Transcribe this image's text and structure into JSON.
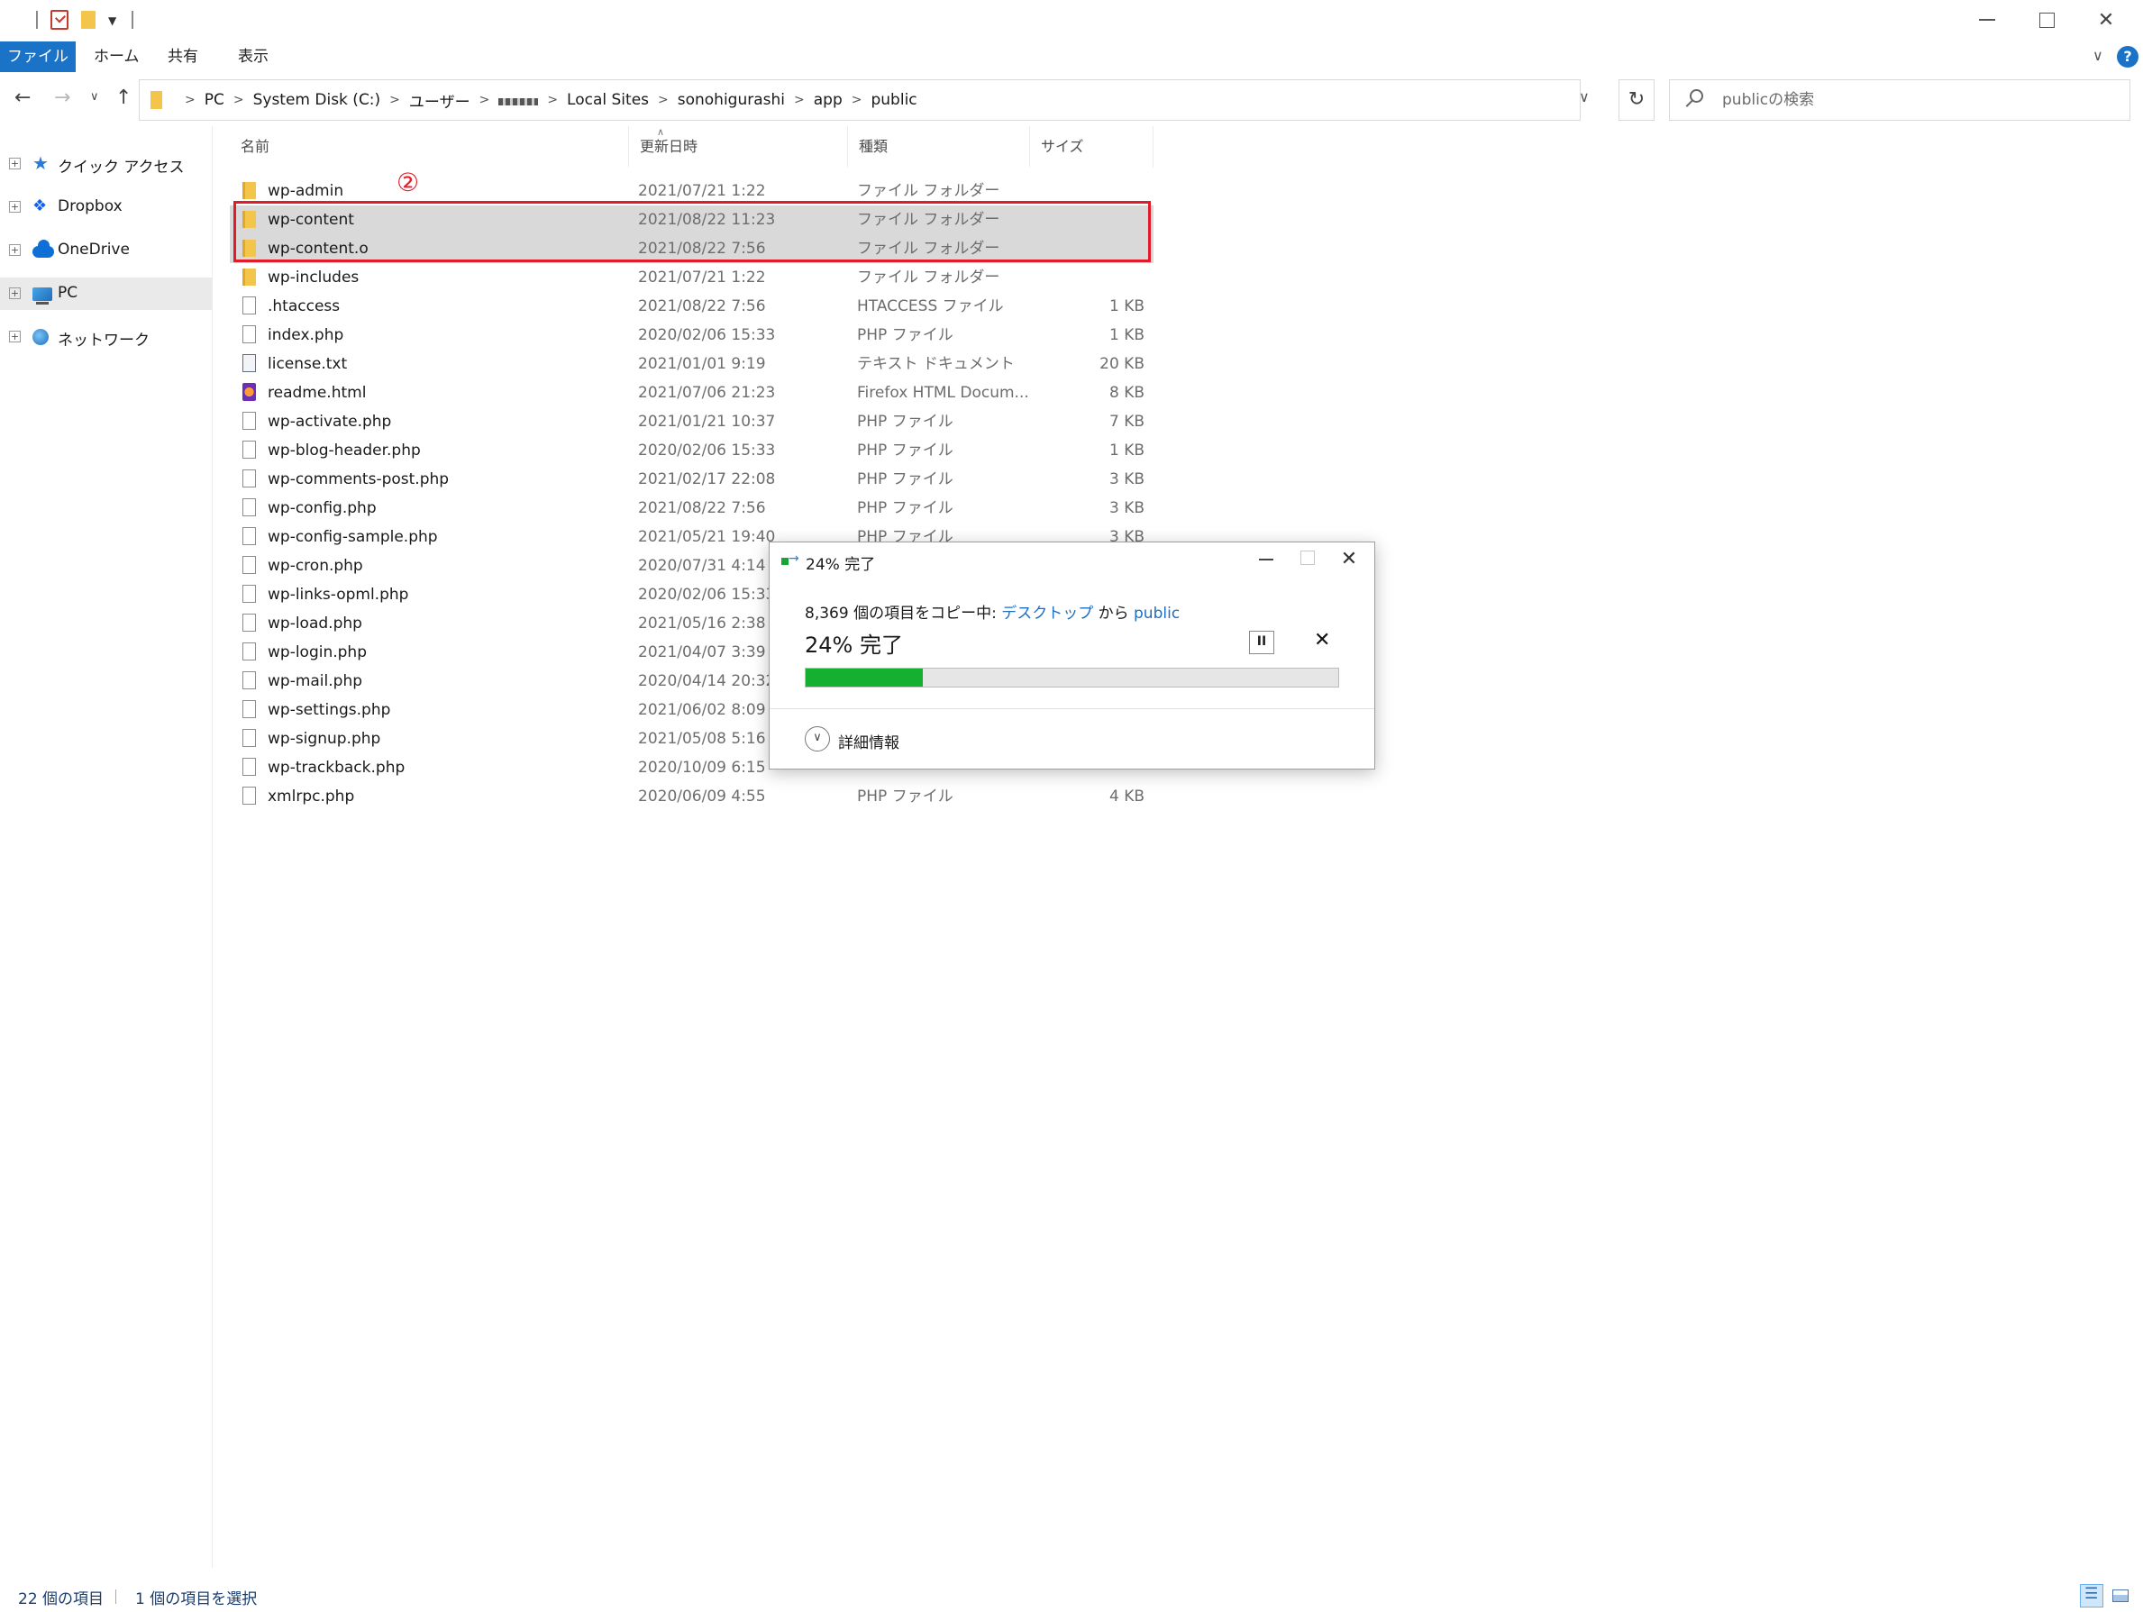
{
  "ribbon": {
    "tabs": [
      "ファイル",
      "ホーム",
      "共有",
      "表示"
    ]
  },
  "address": {
    "crumbs": [
      "PC",
      "System Disk (C:)",
      "ユーザー",
      "Local Sites",
      "sonohigurashi",
      "app",
      "public"
    ]
  },
  "search": {
    "placeholder": "publicの検索"
  },
  "nav": {
    "items": [
      "クイック アクセス",
      "Dropbox",
      "OneDrive",
      "PC",
      "ネットワーク"
    ]
  },
  "columns": {
    "name": "名前",
    "date": "更新日時",
    "type": "種類",
    "size": "サイズ"
  },
  "annotation": "②",
  "files": [
    {
      "name": "wp-admin",
      "date": "2021/07/21 1:22",
      "type": "ファイル フォルダー",
      "size": "",
      "icon": "folder"
    },
    {
      "name": "wp-content",
      "date": "2021/08/22 11:23",
      "type": "ファイル フォルダー",
      "size": "",
      "icon": "folder"
    },
    {
      "name": "wp-content.o",
      "date": "2021/08/22 7:56",
      "type": "ファイル フォルダー",
      "size": "",
      "icon": "folder"
    },
    {
      "name": "wp-includes",
      "date": "2021/07/21 1:22",
      "type": "ファイル フォルダー",
      "size": "",
      "icon": "folder"
    },
    {
      "name": ".htaccess",
      "date": "2021/08/22 7:56",
      "type": "HTACCESS ファイル",
      "size": "1 KB",
      "icon": "file"
    },
    {
      "name": "index.php",
      "date": "2020/02/06 15:33",
      "type": "PHP ファイル",
      "size": "1 KB",
      "icon": "file"
    },
    {
      "name": "license.txt",
      "date": "2021/01/01 9:19",
      "type": "テキスト ドキュメント",
      "size": "20 KB",
      "icon": "txt"
    },
    {
      "name": "readme.html",
      "date": "2021/07/06 21:23",
      "type": "Firefox HTML Docum...",
      "size": "8 KB",
      "icon": "firefox"
    },
    {
      "name": "wp-activate.php",
      "date": "2021/01/21 10:37",
      "type": "PHP ファイル",
      "size": "7 KB",
      "icon": "file"
    },
    {
      "name": "wp-blog-header.php",
      "date": "2020/02/06 15:33",
      "type": "PHP ファイル",
      "size": "1 KB",
      "icon": "file"
    },
    {
      "name": "wp-comments-post.php",
      "date": "2021/02/17 22:08",
      "type": "PHP ファイル",
      "size": "3 KB",
      "icon": "file"
    },
    {
      "name": "wp-config.php",
      "date": "2021/08/22 7:56",
      "type": "PHP ファイル",
      "size": "3 KB",
      "icon": "file"
    },
    {
      "name": "wp-config-sample.php",
      "date": "2021/05/21 19:40",
      "type": "PHP ファイル",
      "size": "3 KB",
      "icon": "file"
    },
    {
      "name": "wp-cron.php",
      "date": "2020/07/31 4:14",
      "type": "",
      "size": "",
      "icon": "file"
    },
    {
      "name": "wp-links-opml.php",
      "date": "2020/02/06 15:33",
      "type": "",
      "size": "",
      "icon": "file"
    },
    {
      "name": "wp-load.php",
      "date": "2021/05/16 2:38",
      "type": "",
      "size": "",
      "icon": "file"
    },
    {
      "name": "wp-login.php",
      "date": "2021/04/07 3:39",
      "type": "",
      "size": "",
      "icon": "file"
    },
    {
      "name": "wp-mail.php",
      "date": "2020/04/14 20:32",
      "type": "",
      "size": "",
      "icon": "file"
    },
    {
      "name": "wp-settings.php",
      "date": "2021/06/02 8:09",
      "type": "",
      "size": "",
      "icon": "file"
    },
    {
      "name": "wp-signup.php",
      "date": "2021/05/08 5:16",
      "type": "",
      "size": "",
      "icon": "file"
    },
    {
      "name": "wp-trackback.php",
      "date": "2020/10/09 6:15",
      "type": "",
      "size": "",
      "icon": "file"
    },
    {
      "name": "xmlrpc.php",
      "date": "2020/06/09 4:55",
      "type": "PHP ファイル",
      "size": "4 KB",
      "icon": "file"
    }
  ],
  "dialog": {
    "title": "24% 完了",
    "line_prefix": "8,369 個の項目をコピー中: ",
    "source": "デスクトップ",
    "from": " から ",
    "destination": "public",
    "percent_text": "24% 完了",
    "progress": 0.22,
    "details_label": "詳細情報"
  },
  "status": {
    "count": "22 個の項目",
    "selected": "1 個の項目を選択"
  },
  "colors": {
    "accent": "#1a73c7",
    "progress": "#16b030",
    "annotation": "#e01b2a",
    "folder": "#f3c54a"
  }
}
